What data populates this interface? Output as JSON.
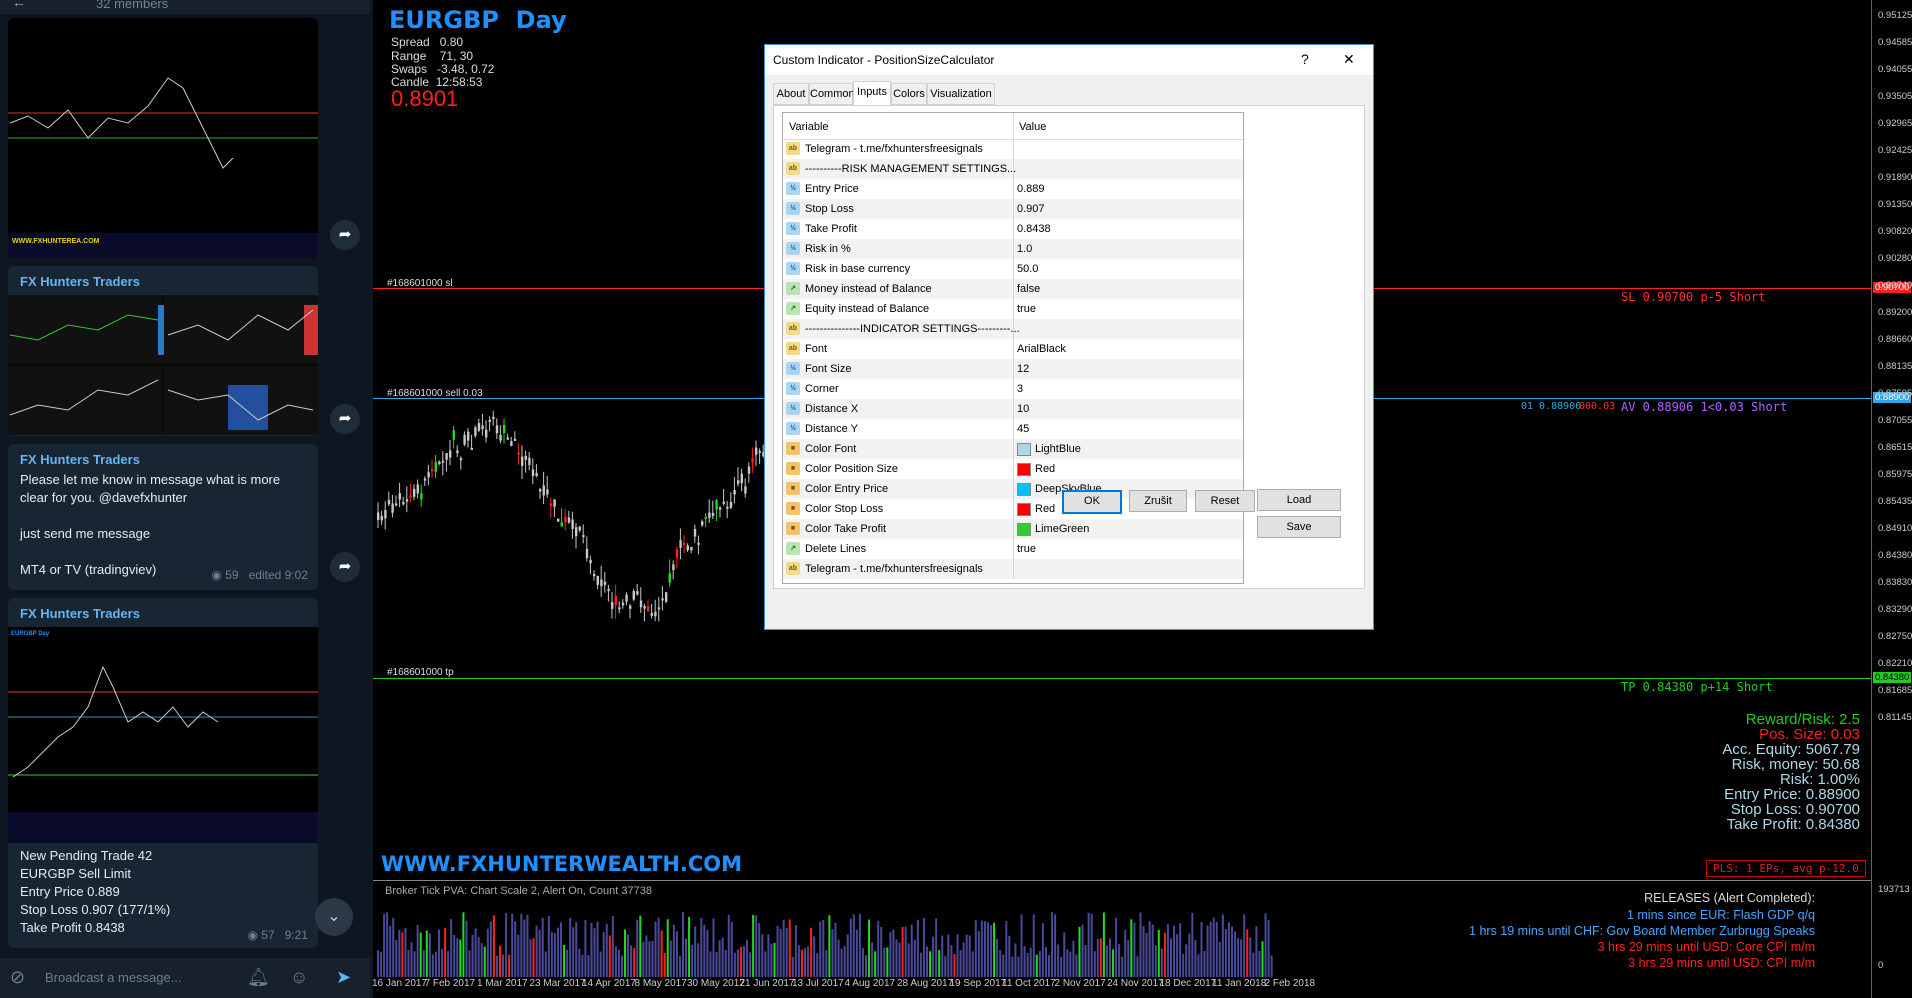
{
  "telegram": {
    "members": "32 members",
    "messages": [
      {
        "sender": "FX Hunters Traders",
        "text_lines": []
      },
      {
        "sender": "FX Hunters Traders",
        "text_lines": [
          "Please let me know in message what is more",
          "clear for you. @davefxhunter",
          "",
          "just send me  message",
          "",
          "MT4 or TV (tradingviev)"
        ],
        "views": "59",
        "time": "edited 9:02"
      },
      {
        "sender": "FX Hunters Traders",
        "text_lines": [
          "New Pending Trade 42",
          "EURGBP Sell Limit",
          "Entry Price 0.889",
          "Stop Loss 0.907 (177/1%)",
          "Take Profit 0.8438"
        ],
        "views": "57",
        "time": "9:21"
      }
    ],
    "composer_placeholder": "Broadcast a message..."
  },
  "chart": {
    "symbol": "EURGBP",
    "timeframe": "Day",
    "spread_label": "Spread",
    "spread": "0.80",
    "range_label": "Range",
    "range": "71, 30",
    "swaps_label": "Swaps",
    "swaps": "-3.48, 0.72",
    "candle_label": "Candle",
    "candle": "12:58:53",
    "price": "0.8901",
    "y_labels": [
      "0.95125",
      "0.94585",
      "0.94055",
      "0.93505",
      "0.92965",
      "0.92425",
      "0.91890",
      "0.91350",
      "0.90820",
      "0.90280",
      "0.89740",
      "0.89200",
      "0.88660",
      "0.88135",
      "0.87595",
      "0.87055",
      "0.86515",
      "0.85975",
      "0.85435",
      "0.84910",
      "0.84380",
      "0.83830",
      "0.83290",
      "0.82750",
      "0.82210",
      "0.81685",
      "0.81145"
    ],
    "y_tags": {
      "sl": "0.90700",
      "entry": "0.88900",
      "tp": "0.84380"
    },
    "levels": {
      "sl_label": "#168601000 sl",
      "entry_label": "#168601000 sell 0.03",
      "tp_label": "#168601000 tp",
      "sl_text": "SL 0.90700 p-5 Short",
      "av_text": "AV 0.88906 1<0.03 Short",
      "av_prefix": "01  0.88906",
      "av_prefix2": "000.03",
      "tp_text": "TP 0.84380 p+14 Short"
    },
    "position_size": {
      "reward_risk": "Reward/Risk:  2.5",
      "pos_size": "Pos. Size:   0.03",
      "acc_equity": "Acc. Equity:  5067.79",
      "risk_money": "Risk, money:  50.68",
      "risk": "Risk:    1.00%",
      "entry_price": "Entry Price:   0.88900",
      "stop_loss": "Stop Loss:   0.90700",
      "take_profit": "Take Profit:  0.84380"
    },
    "pls": "PLS: 1 EPs, avg p-12.0",
    "website": "WWW.FXHUNTERWEALTH.COM",
    "subwindow": {
      "header": "Broker Tick PVA:   Chart Scale  2,  Alert On,  Count  37738",
      "scale_top": "193713",
      "scale_bottom": "0"
    },
    "dates": [
      "16 Jan 2017",
      "7 Feb 2017",
      "1 Mar 2017",
      "23 Mar 2017",
      "14 Apr 2017",
      "8 May 2017",
      "30 May 2017",
      "21 Jun 2017",
      "13 Jul 2017",
      "4 Aug 2017",
      "28 Aug 2017",
      "19 Sep 2017",
      "11 Oct 2017",
      "2 Nov 2017",
      "24 Nov 2017",
      "18 Dec 2017",
      "11 Jan 2018",
      "2 Feb 2018"
    ],
    "releases": {
      "title": "RELEASES  (Alert Completed):",
      "items": [
        {
          "text": "1 mins since EUR: Flash GDP q/q",
          "color": "#4aa3ff"
        },
        {
          "text": "1 hrs 19 mins until CHF: Gov Board Member Zurbrugg Speaks",
          "color": "#4aa3ff"
        },
        {
          "text": "3 hrs 29 mins until USD: Core CPI m/m",
          "color": "#ff2020"
        },
        {
          "text": "3 hrs 29 mins until USD: CPI m/m",
          "color": "#ff2020"
        }
      ]
    }
  },
  "dialog": {
    "title": "Custom Indicator - PositionSizeCalculator",
    "help": "?",
    "close": "✕",
    "tabs": [
      "About",
      "Common",
      "Inputs",
      "Colors",
      "Visualization"
    ],
    "active_tab": "Inputs",
    "col_variable": "Variable",
    "col_value": "Value",
    "rows": [
      {
        "icon": "ab",
        "var": "Telegram - t.me/fxhuntersfreesignals",
        "val": ""
      },
      {
        "icon": "ab",
        "var": "----------RISK MANAGEMENT SETTINGS...",
        "val": ""
      },
      {
        "icon": "num",
        "var": "Entry Price",
        "val": "0.889"
      },
      {
        "icon": "num",
        "var": "Stop Loss",
        "val": "0.907"
      },
      {
        "icon": "num",
        "var": "Take Profit",
        "val": "0.8438"
      },
      {
        "icon": "num",
        "var": "Risk in %",
        "val": "1.0"
      },
      {
        "icon": "num",
        "var": "Risk in base currency",
        "val": "50.0"
      },
      {
        "icon": "bool",
        "var": "Money instead of Balance",
        "val": "false"
      },
      {
        "icon": "bool",
        "var": "Equity instead of Balance",
        "val": "true"
      },
      {
        "icon": "ab",
        "var": "---------------INDICATOR SETTINGS---------...",
        "val": ""
      },
      {
        "icon": "ab",
        "var": "Font",
        "val": "ArialBlack"
      },
      {
        "icon": "num",
        "var": "Font Size",
        "val": "12"
      },
      {
        "icon": "num",
        "var": "Corner",
        "val": "3"
      },
      {
        "icon": "num",
        "var": "Distance X",
        "val": "10"
      },
      {
        "icon": "num",
        "var": "Distance Y",
        "val": "45"
      },
      {
        "icon": "clr",
        "var": "Color Font",
        "val": "LightBlue",
        "swatch": "#add8e6"
      },
      {
        "icon": "clr",
        "var": "Color Position Size",
        "val": "Red",
        "swatch": "#ff0000"
      },
      {
        "icon": "clr",
        "var": "Color Entry Price",
        "val": "DeepSkyBlue",
        "swatch": "#00bfff"
      },
      {
        "icon": "clr",
        "var": "Color Stop Loss",
        "val": "Red",
        "swatch": "#ff0000"
      },
      {
        "icon": "clr",
        "var": "Color Take Profit",
        "val": "LimeGreen",
        "swatch": "#32cd32"
      },
      {
        "icon": "bool",
        "var": "Delete Lines",
        "val": "true"
      },
      {
        "icon": "ab",
        "var": "Telegram - t.me/fxhuntersfreesignals",
        "val": ""
      }
    ],
    "icon_text": {
      "ab": "ab",
      "num": "½",
      "bool": "↗",
      "clr": "■"
    },
    "load": "Load",
    "save": "Save",
    "ok": "OK",
    "cancel": "Zrušit",
    "reset": "Reset"
  },
  "colors": {
    "sl_line": "#ff2020",
    "entry_line": "#2fa8e8",
    "tp_line": "#22cc22",
    "bull": "#22dd22",
    "bear": "#ff2020",
    "neutral": "#c8c8c8"
  }
}
